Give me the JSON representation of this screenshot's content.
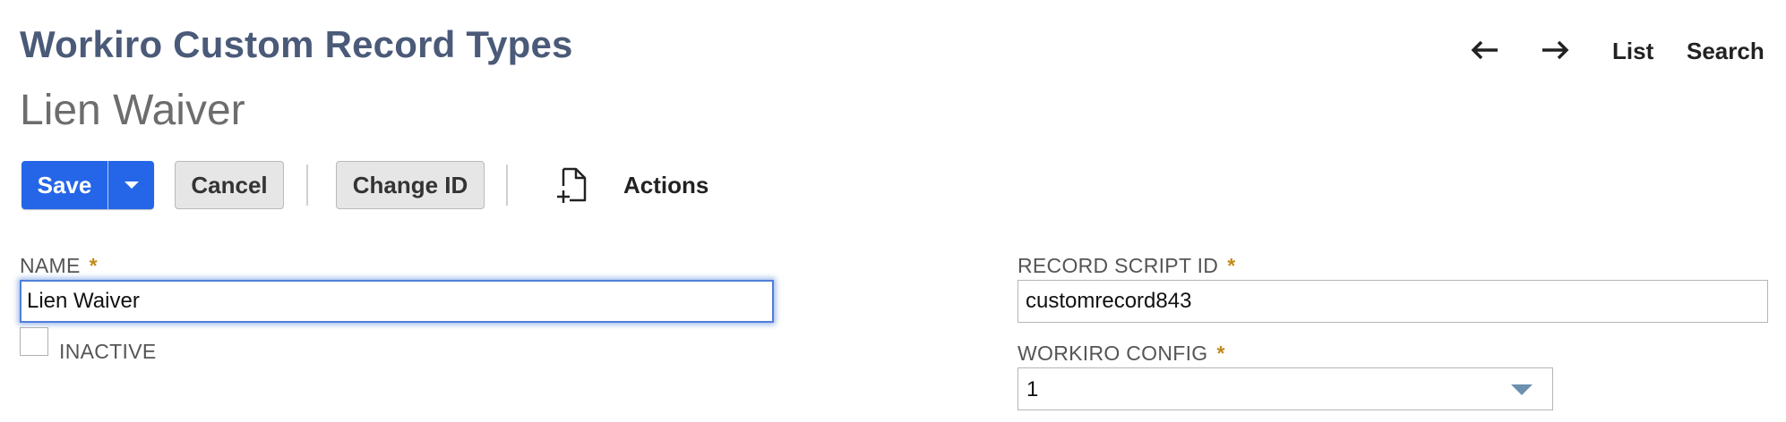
{
  "header": {
    "page_title": "Workiro Custom Record Types",
    "record_title": "Lien Waiver"
  },
  "top_nav": {
    "back_icon": "arrow-left-icon",
    "forward_icon": "arrow-right-icon",
    "list_label": "List",
    "search_label": "Search"
  },
  "toolbar": {
    "save_label": "Save",
    "cancel_label": "Cancel",
    "change_id_label": "Change ID",
    "new_icon": "document-plus-icon",
    "actions_label": "Actions",
    "primary_color": "#2566e8"
  },
  "form": {
    "name": {
      "label": "NAME",
      "required_mark": "*",
      "value": "Lien Waiver"
    },
    "inactive": {
      "label": "INACTIVE",
      "checked": false
    },
    "record_script_id": {
      "label": "RECORD SCRIPT ID",
      "required_mark": "*",
      "value": "customrecord843"
    },
    "workiro_config": {
      "label": "WORKIRO CONFIG",
      "required_mark": "*",
      "value": "1"
    },
    "required_color": "#c28a1b"
  }
}
